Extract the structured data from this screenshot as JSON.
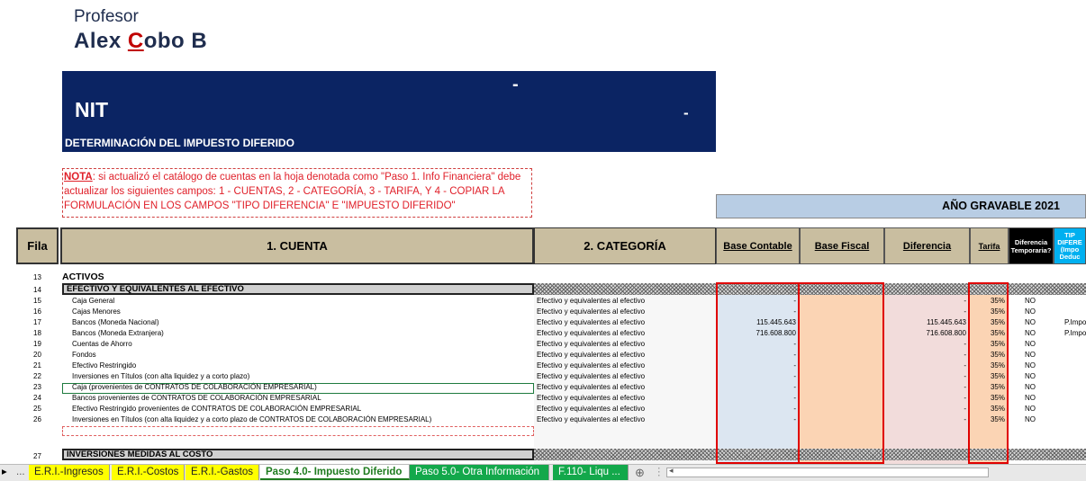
{
  "header": {
    "profesor": "Profesor",
    "author_prefix": "Alex ",
    "author_c": "C",
    "author_suffix": "obo B"
  },
  "banner": {
    "dash1": "-",
    "nit": "NIT",
    "dash2": "-",
    "subtitle": "DETERMINACIÓN DEL IMPUESTO DIFERIDO"
  },
  "nota": {
    "label": "NOTA",
    "text": ": si actualizó el catálogo de cuentas en la hoja denotada como \"Paso 1. Info Financiera\" debe actualizar los siguientes campos: 1 - CUENTAS, 2 - CATEGORÍA, 3 - TARIFA, Y 4 - COPIAR LA FORMULACIÓN EN LOS CAMPOS \"TIPO DIFERENCIA\" E \"IMPUESTO DIFERIDO\""
  },
  "ano_gravable": "AÑO GRAVABLE 2021",
  "columns": {
    "fila": "Fila",
    "cuenta": "1. CUENTA",
    "categoria": "2. CATEGORÍA",
    "base_contable": "Base Contable",
    "base_fiscal": "Base Fiscal",
    "diferencia": "Diferencia",
    "tarifa": "Tarifa",
    "dif_temporaria": "Diferencia Temporaria?",
    "tipo_diferencia": "TIP DIFERE (Impo Deduc"
  },
  "sections": {
    "activos": "ACTIVOS",
    "efectivo": "EFECTIVO Y EQUIVALENTES AL EFECTIVO",
    "inversiones": "INVERSIONES MEDIDAS AL COSTO"
  },
  "row_numbers": {
    "r13": "13",
    "r14": "14",
    "r27": "27"
  },
  "rows": [
    {
      "fila": "15",
      "cuenta": "Caja General",
      "categoria": "Efectivo y equivalentes al efectivo",
      "base_contable": "-",
      "diferencia": "-",
      "tarifa": "35%",
      "dif_temp": "NO",
      "tipo": ""
    },
    {
      "fila": "16",
      "cuenta": "Cajas Menores",
      "categoria": "Efectivo y equivalentes al efectivo",
      "base_contable": "-",
      "diferencia": "-",
      "tarifa": "35%",
      "dif_temp": "NO",
      "tipo": ""
    },
    {
      "fila": "17",
      "cuenta": "Bancos (Moneda Nacional)",
      "categoria": "Efectivo y equivalentes al efectivo",
      "base_contable": "115.445.643",
      "diferencia": "115.445.643",
      "tarifa": "35%",
      "dif_temp": "NO",
      "tipo": "P.Impo"
    },
    {
      "fila": "18",
      "cuenta": "Bancos (Moneda Extranjera)",
      "categoria": "Efectivo y equivalentes al efectivo",
      "base_contable": "716.608.800",
      "diferencia": "716.608.800",
      "tarifa": "35%",
      "dif_temp": "NO",
      "tipo": "P.Impo"
    },
    {
      "fila": "19",
      "cuenta": "Cuentas de Ahorro",
      "categoria": "Efectivo y equivalentes al efectivo",
      "base_contable": "-",
      "diferencia": "-",
      "tarifa": "35%",
      "dif_temp": "NO",
      "tipo": ""
    },
    {
      "fila": "20",
      "cuenta": "Fondos",
      "categoria": "Efectivo y equivalentes al efectivo",
      "base_contable": "-",
      "diferencia": "-",
      "tarifa": "35%",
      "dif_temp": "NO",
      "tipo": ""
    },
    {
      "fila": "21",
      "cuenta": "Efectivo Restringido",
      "categoria": "Efectivo y equivalentes al efectivo",
      "base_contable": "-",
      "diferencia": "-",
      "tarifa": "35%",
      "dif_temp": "NO",
      "tipo": ""
    },
    {
      "fila": "22",
      "cuenta": "Inversiones en Títulos (con alta liquidez y a corto plazo)",
      "categoria": "Efectivo y equivalentes al efectivo",
      "base_contable": "-",
      "diferencia": "-",
      "tarifa": "35%",
      "dif_temp": "NO",
      "tipo": ""
    },
    {
      "fila": "23",
      "cuenta": "Caja (provenientes de CONTRATOS DE COLABORACIÓN EMPRESARIAL)",
      "categoria": "Efectivo y equivalentes al efectivo",
      "base_contable": "-",
      "diferencia": "-",
      "tarifa": "35%",
      "dif_temp": "NO",
      "tipo": ""
    },
    {
      "fila": "24",
      "cuenta": "Bancos provenientes de CONTRATOS DE COLABORACIÓN EMPRESARIAL",
      "categoria": "Efectivo y equivalentes al efectivo",
      "base_contable": "-",
      "diferencia": "-",
      "tarifa": "35%",
      "dif_temp": "NO",
      "tipo": ""
    },
    {
      "fila": "25",
      "cuenta": "Efectivo Restringido provenientes de CONTRATOS DE COLABORACIÓN EMPRESARIAL",
      "categoria": "Efectivo y equivalentes al efectivo",
      "base_contable": "-",
      "diferencia": "-",
      "tarifa": "35%",
      "dif_temp": "NO",
      "tipo": ""
    },
    {
      "fila": "26",
      "cuenta": "Inversiones en Títulos (con alta liquidez y a corto plazo de CONTRATOS DE COLABORACIÓN EMPRESARIAL)",
      "categoria": "Efectivo y equivalentes al efectivo",
      "base_contable": "-",
      "diferencia": "-",
      "tarifa": "35%",
      "dif_temp": "NO",
      "tipo": ""
    }
  ],
  "tabs": {
    "nav": "...",
    "items": [
      "E.R.I.-Ingresos",
      "E.R.I.-Costos",
      "E.R.I.-Gastos",
      "Paso 4.0- Impuesto Diferido",
      "Paso 5.0- Otra Información",
      "F.110- Liqu ..."
    ]
  }
}
